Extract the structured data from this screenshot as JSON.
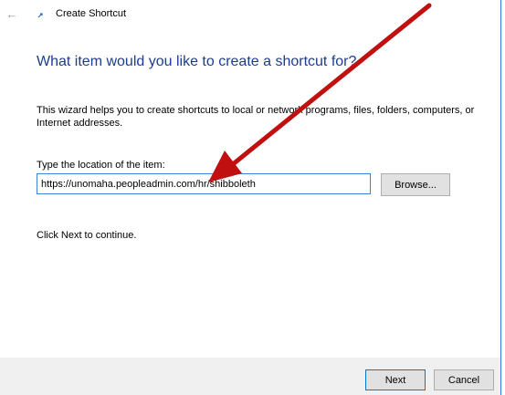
{
  "window": {
    "title": "Create Shortcut"
  },
  "wizard": {
    "heading": "What item would you like to create a shortcut for?",
    "description": "This wizard helps you to create shortcuts to local or network programs, files, folders, computers, or Internet addresses.",
    "location_label": "Type the location of the item:",
    "location_value": "https://unomaha.peopleadmin.com/hr/shibboleth",
    "browse_label": "Browse...",
    "continue_text": "Click Next to continue."
  },
  "footer": {
    "next_label": "Next",
    "cancel_label": "Cancel"
  },
  "icons": {
    "back": "back-arrow-icon",
    "title": "shortcut-icon"
  },
  "colors": {
    "heading": "#1c3d8f",
    "annotation_arrow": "#c01010",
    "input_border": "#3c83d6"
  }
}
